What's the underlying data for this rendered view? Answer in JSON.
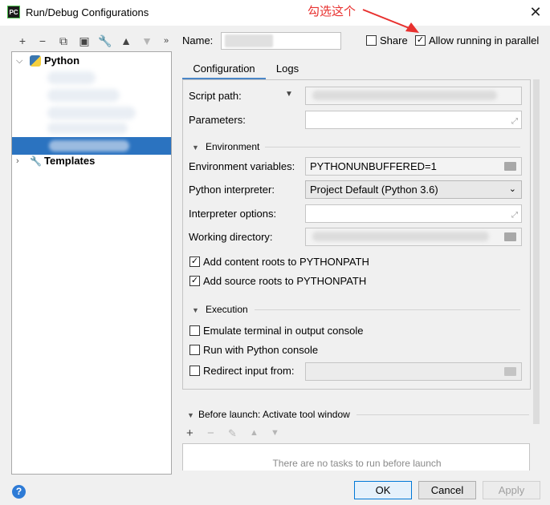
{
  "window": {
    "title": "Run/Debug Configurations",
    "app_icon": "PC"
  },
  "annotation": {
    "text": "勾选这个"
  },
  "toolbar": {
    "icons": [
      "plus-icon",
      "minus-icon",
      "copy-icon",
      "save-icon",
      "wrench-icon",
      "arrow-up-icon",
      "arrow-down-icon",
      "more-icon"
    ]
  },
  "tree": {
    "python_label": "Python",
    "templates_label": "Templates"
  },
  "name_row": {
    "name_label": "Name:",
    "share_label": "Share",
    "share_checked": false,
    "allow_parallel_label": "Allow running in parallel",
    "allow_parallel_checked": true
  },
  "tabs": {
    "configuration": "Configuration",
    "logs": "Logs"
  },
  "config": {
    "script_path_label": "Script path:",
    "parameters_label": "Parameters:",
    "environment_section": "Environment",
    "env_vars_label": "Environment variables:",
    "env_vars_value": "PYTHONUNBUFFERED=1",
    "interpreter_label": "Python interpreter:",
    "interpreter_value": "Project Default (Python 3.6)",
    "interp_options_label": "Interpreter options:",
    "working_dir_label": "Working directory:",
    "add_content_roots_label": "Add content roots to PYTHONPATH",
    "add_source_roots_label": "Add source roots to PYTHONPATH",
    "execution_section": "Execution",
    "emulate_terminal_label": "Emulate terminal in output console",
    "run_python_console_label": "Run with Python console",
    "redirect_input_label": "Redirect input from:"
  },
  "before_launch": {
    "header": "Before launch: Activate tool window",
    "empty_text": "There are no tasks to run before launch"
  },
  "buttons": {
    "ok": "OK",
    "cancel": "Cancel",
    "apply": "Apply"
  },
  "colors": {
    "accent": "#4a86c7",
    "selection": "#2b73c0",
    "annotation": "#e8312f"
  }
}
